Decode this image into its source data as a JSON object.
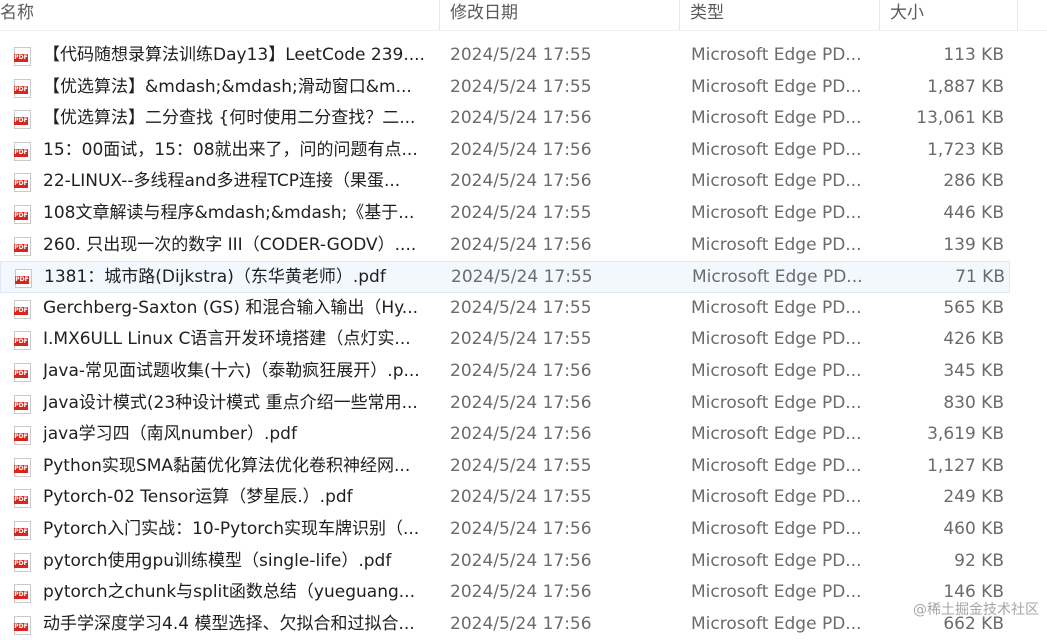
{
  "columns": {
    "name": "名称",
    "date": "修改日期",
    "type": "类型",
    "size": "大小"
  },
  "files": [
    {
      "name": "【代码随想录算法训练Day13】LeetCode 239....",
      "date": "2024/5/24 17:55",
      "type": "Microsoft Edge PD...",
      "size": "113 KB"
    },
    {
      "name": "【优选算法】&mdash;&mdash;滑动窗口&m...",
      "date": "2024/5/24 17:55",
      "type": "Microsoft Edge PD...",
      "size": "1,887 KB"
    },
    {
      "name": "【优选算法】二分查找 {何时使用二分查找？二...",
      "date": "2024/5/24 17:56",
      "type": "Microsoft Edge PD...",
      "size": "13,061 KB"
    },
    {
      "name": "15：00面试，15：08就出来了，问的问题有点...",
      "date": "2024/5/24 17:56",
      "type": "Microsoft Edge PD...",
      "size": "1,723 KB"
    },
    {
      "name": "22-LINUX--多线程and多进程TCP连接（果蛋...",
      "date": "2024/5/24 17:56",
      "type": "Microsoft Edge PD...",
      "size": "286 KB"
    },
    {
      "name": "108文章解读与程序&mdash;&mdash;《基于...",
      "date": "2024/5/24 17:55",
      "type": "Microsoft Edge PD...",
      "size": "446 KB"
    },
    {
      "name": "260. 只出现一次的数字 III（CODER-GODV）....",
      "date": "2024/5/24 17:56",
      "type": "Microsoft Edge PD...",
      "size": "139 KB"
    },
    {
      "name": "1381：城市路(Dijkstra)（东华黄老师）.pdf",
      "date": "2024/5/24 17:55",
      "type": "Microsoft Edge PD...",
      "size": "71 KB",
      "selected": true
    },
    {
      "name": "Gerchberg-Saxton (GS) 和混合输入输出（Hy...",
      "date": "2024/5/24 17:55",
      "type": "Microsoft Edge PD...",
      "size": "565 KB"
    },
    {
      "name": "I.MX6ULL Linux C语言开发环境搭建（点灯实...",
      "date": "2024/5/24 17:55",
      "type": "Microsoft Edge PD...",
      "size": "426 KB"
    },
    {
      "name": "Java-常见面试题收集(十六)（泰勒疯狂展开）.p...",
      "date": "2024/5/24 17:56",
      "type": "Microsoft Edge PD...",
      "size": "345 KB"
    },
    {
      "name": "Java设计模式(23种设计模式 重点介绍一些常用...",
      "date": "2024/5/24 17:56",
      "type": "Microsoft Edge PD...",
      "size": "830 KB"
    },
    {
      "name": "java学习四（南风number）.pdf",
      "date": "2024/5/24 17:56",
      "type": "Microsoft Edge PD...",
      "size": "3,619 KB"
    },
    {
      "name": "Python实现SMA黏菌优化算法优化卷积神经网...",
      "date": "2024/5/24 17:55",
      "type": "Microsoft Edge PD...",
      "size": "1,127 KB"
    },
    {
      "name": "Pytorch-02 Tensor运算（梦星辰.）.pdf",
      "date": "2024/5/24 17:55",
      "type": "Microsoft Edge PD...",
      "size": "249 KB"
    },
    {
      "name": "Pytorch入门实战：10-Pytorch实现车牌识别（...",
      "date": "2024/5/24 17:56",
      "type": "Microsoft Edge PD...",
      "size": "460 KB"
    },
    {
      "name": "pytorch使用gpu训练模型（single-life）.pdf",
      "date": "2024/5/24 17:56",
      "type": "Microsoft Edge PD...",
      "size": "92 KB"
    },
    {
      "name": "pytorch之chunk与split函数总结（yueguang...",
      "date": "2024/5/24 17:56",
      "type": "Microsoft Edge PD...",
      "size": "146 KB"
    },
    {
      "name": "动手学深度学习4.4 模型选择、欠拟合和过拟合...",
      "date": "2024/5/24 17:56",
      "type": "Microsoft Edge PD...",
      "size": "662 KB"
    }
  ],
  "icon": {
    "name": "pdf-icon",
    "label": "PDF",
    "accent": "#d9261c"
  },
  "watermark": "@稀土掘金技术社区"
}
